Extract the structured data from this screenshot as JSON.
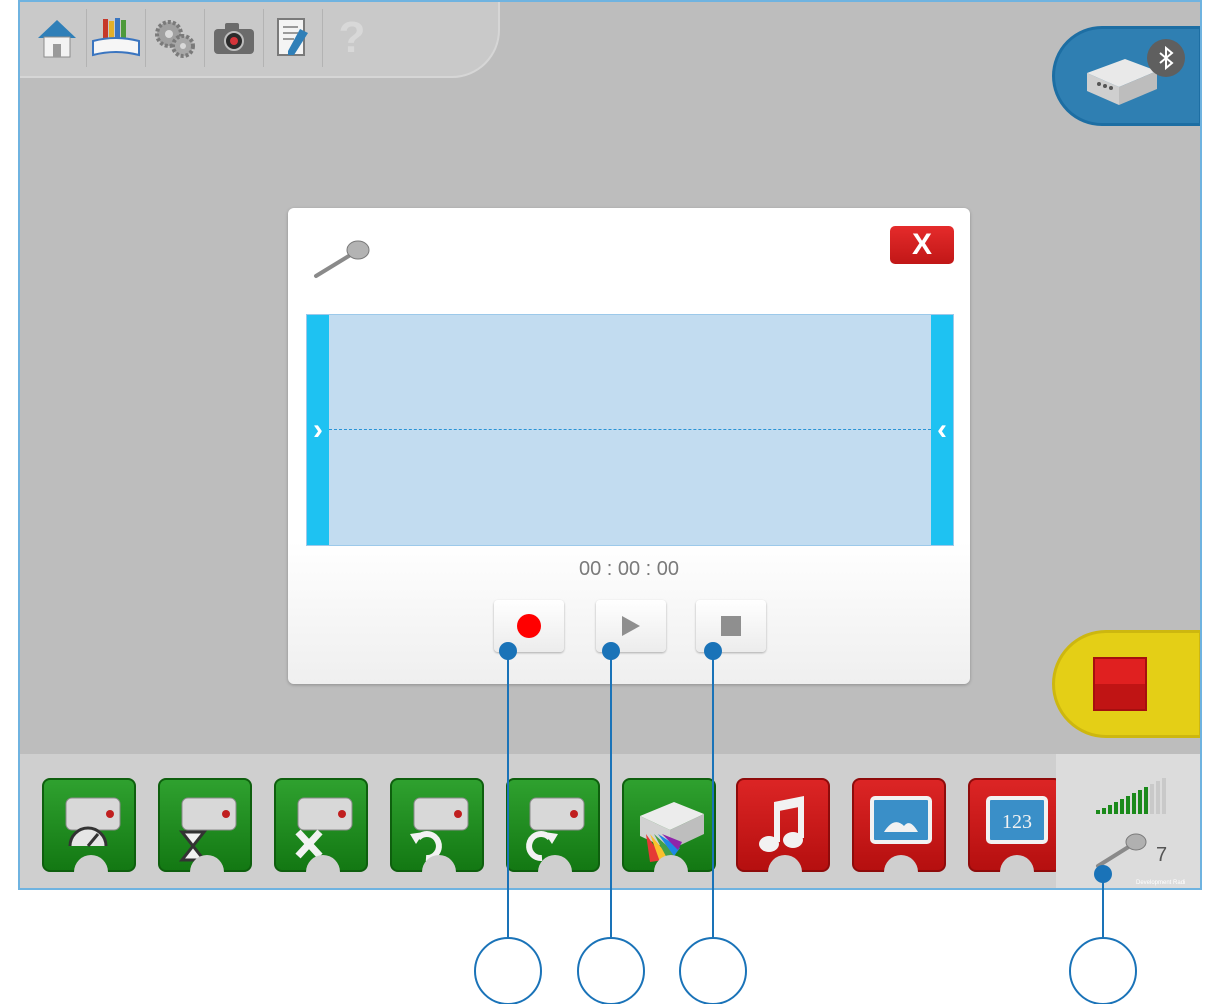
{
  "toolbar": {
    "icons": [
      "home-icon",
      "books-icon",
      "gears-icon",
      "camera-icon",
      "document-edit-icon",
      "help-icon"
    ],
    "help_label": "?"
  },
  "hub": {
    "icon": "smarthub-icon",
    "badge_icon": "bluetooth-icon"
  },
  "stop_button": {
    "icon": "stop-icon",
    "color": "#e4cf16"
  },
  "dialog": {
    "close_label": "X",
    "icon": "microphone-icon",
    "timer": "00 : 00 : 00",
    "controls": {
      "record_icon": "record-icon",
      "play_icon": "play-icon",
      "stop_icon": "stop-icon"
    },
    "trim_left": "›",
    "trim_right": "‹"
  },
  "palette": {
    "blocks": [
      {
        "icon": "motor-speed-icon",
        "color": "green"
      },
      {
        "icon": "motor-time-icon",
        "color": "green"
      },
      {
        "icon": "motor-off-icon",
        "color": "green"
      },
      {
        "icon": "motor-counterclockwise-icon",
        "color": "green"
      },
      {
        "icon": "motor-clockwise-icon",
        "color": "green"
      },
      {
        "icon": "hub-light-color-icon",
        "color": "green"
      },
      {
        "icon": "music-note-icon",
        "color": "red"
      },
      {
        "icon": "display-image-icon",
        "color": "red"
      },
      {
        "icon": "display-number-icon",
        "color": "red"
      }
    ]
  },
  "sensor_panel": {
    "value": "7",
    "caption": "Development Radi",
    "icon": "microphone-icon",
    "signal_level": 0.6
  },
  "colors": {
    "accent": "#1a73b8",
    "record": "#ff0000",
    "waveform_bg": "#c2dcf0",
    "trim_handle": "#1ec2f2"
  }
}
